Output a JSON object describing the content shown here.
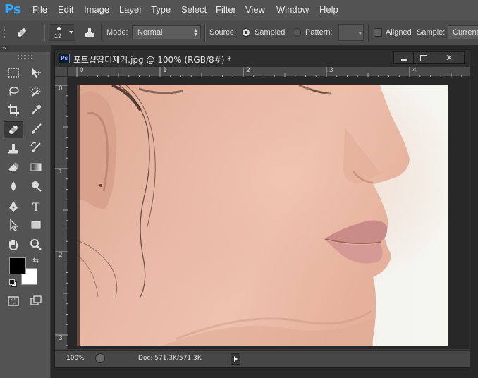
{
  "app": {
    "logo_text": "Ps"
  },
  "menu": [
    "File",
    "Edit",
    "Image",
    "Layer",
    "Type",
    "Select",
    "Filter",
    "View",
    "Window",
    "Help"
  ],
  "options": {
    "brush_size": "19",
    "mode_label": "Mode:",
    "mode_value": "Normal",
    "source_label": "Source:",
    "sampled_label": "Sampled",
    "pattern_label": "Pattern:",
    "aligned_label": "Aligned",
    "sample_label": "Sample:",
    "sample_value": "Current"
  },
  "document": {
    "icon_text": "Ps",
    "title": "포토샵잡티제거.jpg @ 100% (RGB/8#) *",
    "ruler_top": [
      "0",
      "1",
      "2",
      "3",
      "4"
    ],
    "ruler_left": [
      "0",
      "1",
      "2",
      "3"
    ],
    "zoom": "100%",
    "doc_info": "Doc: 571.3K/571.3K"
  },
  "colors": {
    "foreground": "#000000",
    "background": "#ffffff"
  }
}
